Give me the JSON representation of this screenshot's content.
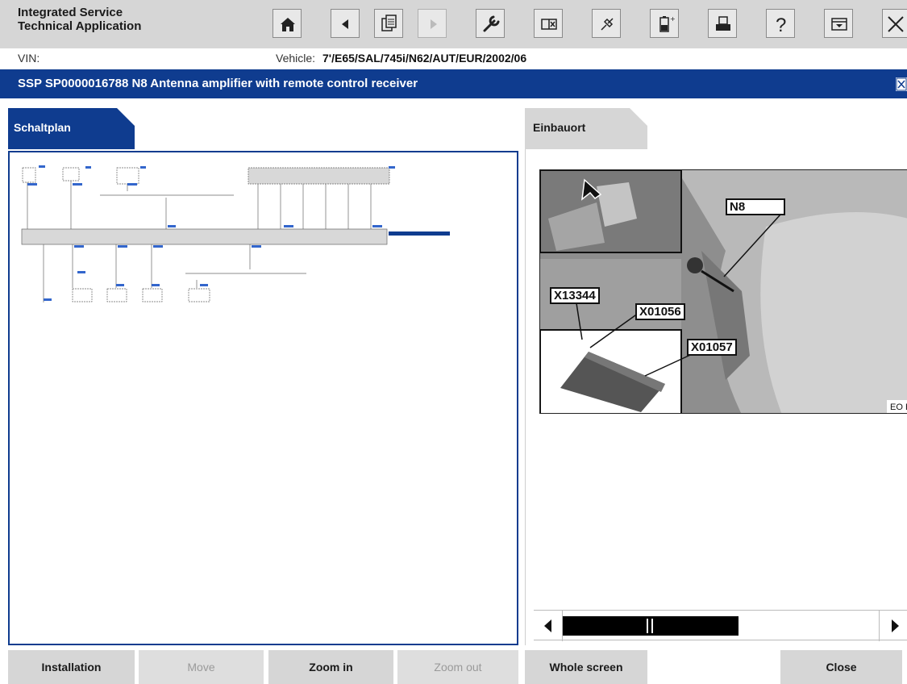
{
  "app": {
    "title_line1": "Integrated Service",
    "title_line2": "Technical Application"
  },
  "toolbar": [
    {
      "name": "home",
      "icon": "home-icon"
    },
    {
      "name": "back",
      "icon": "arrow-left-icon"
    },
    {
      "name": "documents",
      "icon": "documents-icon"
    },
    {
      "name": "forward",
      "icon": "arrow-right-icon",
      "disabled": true
    },
    {
      "name": "service-functions",
      "icon": "wrench-icon"
    },
    {
      "name": "vehicle-info",
      "icon": "info-panel-icon"
    },
    {
      "name": "measurement",
      "icon": "connector-icon"
    },
    {
      "name": "battery",
      "icon": "battery-icon"
    },
    {
      "name": "print",
      "icon": "printer-icon"
    },
    {
      "name": "help",
      "icon": "help-icon"
    },
    {
      "name": "minimize",
      "icon": "minimize-icon"
    },
    {
      "name": "exit",
      "icon": "close-icon"
    }
  ],
  "vin": {
    "label": "VIN:"
  },
  "vehicle": {
    "label": "Vehicle:",
    "value": "7'/E65/SAL/745i/N62/AUT/EUR/2002/06"
  },
  "document": {
    "title": "SSP SP0000016788 N8 Antenna amplifier with remote control receiver"
  },
  "tabs": {
    "schaltplan": "Schaltplan",
    "einbauort": "Einbauort"
  },
  "photo": {
    "callouts": {
      "n8": "N8",
      "x13344": "X13344",
      "x01056": "X01056",
      "x01057": "X01057"
    },
    "corner_text": "EO EO"
  },
  "footer": {
    "installation": "Installation",
    "move": "Move",
    "zoom_in": "Zoom in",
    "zoom_out": "Zoom out",
    "whole_screen": "Whole screen",
    "close": "Close"
  },
  "colors": {
    "brand_blue": "#0f3c8f",
    "toolbar_gray": "#d6d6d6",
    "link_blue": "#3366cc"
  }
}
